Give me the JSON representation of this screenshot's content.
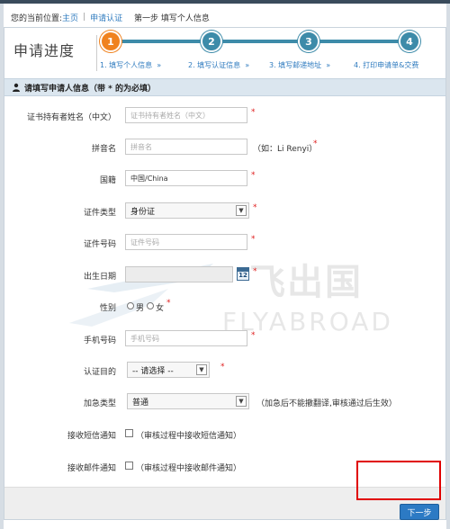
{
  "breadcrumb": {
    "prefix": "您的当前位置:",
    "home": "主页",
    "section": "申请认证",
    "current": "第一步 填写个人信息"
  },
  "progress": {
    "title": "申请进度",
    "steps": [
      {
        "number": "1",
        "label": "1. 填写个人信息",
        "active": true
      },
      {
        "number": "2",
        "label": "2. 填写认证信息",
        "active": false
      },
      {
        "number": "3",
        "label": "3. 填写邮递地址",
        "active": false
      },
      {
        "number": "4",
        "label": "4. 打印申请单&交费",
        "active": false
      }
    ],
    "chevron": "»"
  },
  "section": {
    "title": "请填写申请人信息（带 * 的为必填）"
  },
  "form": {
    "name_cn": {
      "label": "证书持有者姓名（中文）",
      "placeholder": "证书持有者姓名（中文）"
    },
    "pinyin": {
      "label": "拼音名",
      "placeholder": "拼音名",
      "note": "（如：Li Renyi）"
    },
    "nationality": {
      "label": "国籍",
      "value": "中国/China"
    },
    "id_type": {
      "label": "证件类型",
      "value": "身份证"
    },
    "id_number": {
      "label": "证件号码",
      "placeholder": "证件号码"
    },
    "birth_date": {
      "label": "出生日期",
      "calendar_text": "12"
    },
    "gender": {
      "label": "性别",
      "male": "男",
      "female": "女"
    },
    "phone": {
      "label": "手机号码",
      "placeholder": "手机号码"
    },
    "purpose": {
      "label": "认证目的",
      "value": "-- 请选择 --"
    },
    "urgency": {
      "label": "加急类型",
      "value": "普通",
      "note": "（加急后不能撤翻译,审核通过后生效）"
    },
    "sms_notify": {
      "label": "接收短信通知",
      "text": "（审核过程中接收短信通知）"
    },
    "email_notify": {
      "label": "接收邮件通知",
      "text": "（审核过程中接收邮件通知）"
    },
    "required_mark": "*"
  },
  "actions": {
    "next_label": "下一步"
  },
  "watermark": {
    "cn": "飞出国",
    "en": "FLYABROAD"
  },
  "colors": {
    "accent": "#3d8ba9",
    "active_step": "#f0821e",
    "link": "#2f7bbf",
    "required": "#e02020",
    "button": "#2c7ac4",
    "highlight": "#e00000"
  }
}
